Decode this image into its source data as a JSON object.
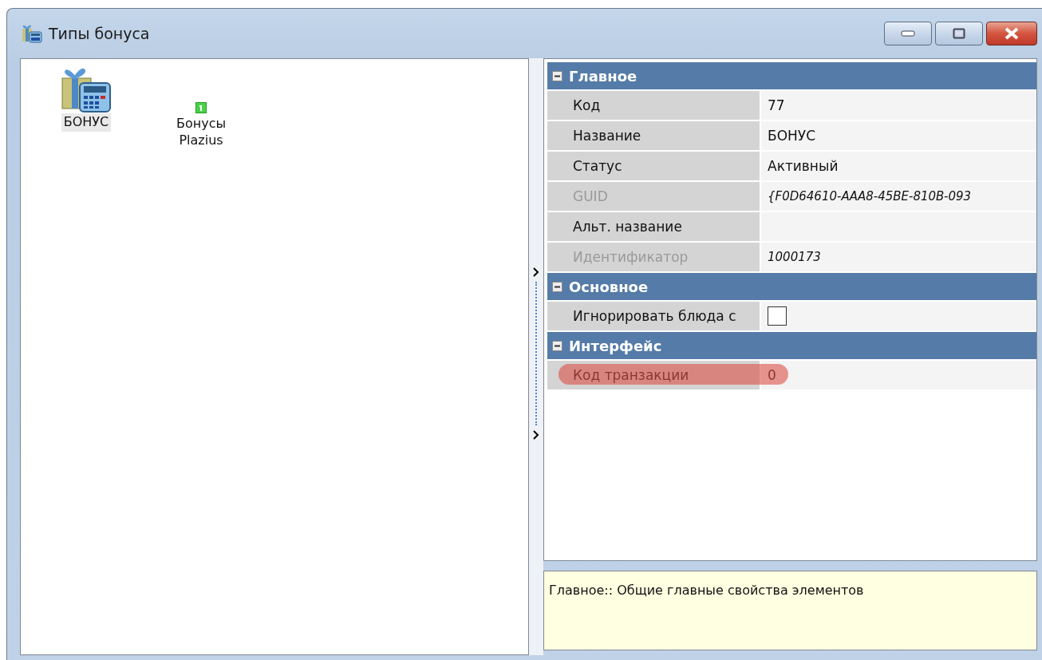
{
  "window": {
    "title": "Типы бонуса"
  },
  "items": [
    {
      "label": "БОНУС",
      "kind": "gift",
      "selected": true
    },
    {
      "label": "Бонусы Plazius",
      "kind": "badge",
      "selected": false
    }
  ],
  "groups": [
    {
      "title": "Главное",
      "expanded": true,
      "rows": [
        {
          "label": "Код",
          "value": "77",
          "kind": "text",
          "disabled": false,
          "highlighted": false
        },
        {
          "label": "Название",
          "value": "БОНУС",
          "kind": "text",
          "disabled": false,
          "highlighted": false
        },
        {
          "label": "Статус",
          "value": "Активный",
          "kind": "text",
          "disabled": false,
          "highlighted": false
        },
        {
          "label": "GUID",
          "value": "{F0D64610-AAA8-45BE-810B-093",
          "kind": "text",
          "disabled": true,
          "highlighted": false
        },
        {
          "label": "Альт. название",
          "value": "",
          "kind": "text",
          "disabled": false,
          "highlighted": false
        },
        {
          "label": "Идентификатор",
          "value": "1000173",
          "kind": "text",
          "disabled": true,
          "highlighted": false
        }
      ]
    },
    {
      "title": "Основное",
      "expanded": true,
      "rows": [
        {
          "label": "Игнорировать блюда с",
          "kind": "checkbox",
          "checked": false,
          "disabled": false,
          "highlighted": false
        }
      ]
    },
    {
      "title": "Интерфейс",
      "expanded": true,
      "rows": [
        {
          "label": "Код транзакции",
          "value": "0",
          "kind": "text",
          "disabled": false,
          "highlighted": true
        }
      ]
    }
  ],
  "description": "Главное:: Общие главные свойства элементов"
}
